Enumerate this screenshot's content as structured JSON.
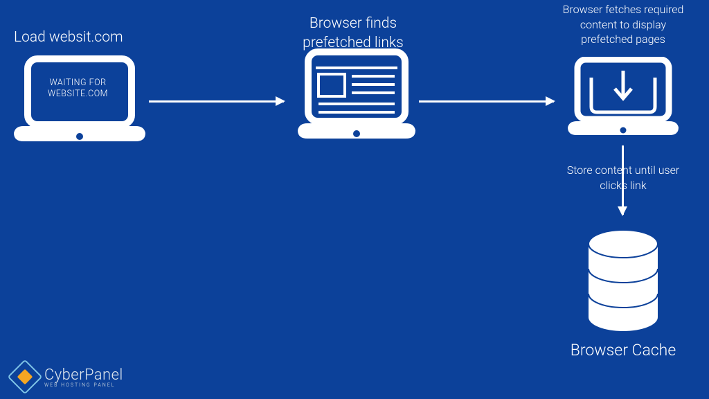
{
  "steps": {
    "s1": {
      "label": "Load websit.com",
      "screen_text": "WAITING FOR WEBSITE.COM"
    },
    "s2": {
      "label": "Browser finds prefetched links"
    },
    "s3": {
      "label": "Browser fetches required content to display prefetched pages"
    },
    "s4": {
      "label": "Store content until user clicks link"
    }
  },
  "cache": {
    "label": "Browser Cache"
  },
  "brand": {
    "name": "CyberPanel",
    "tagline": "WEB HOSTING PANEL"
  },
  "colors": {
    "bg": "#0c419a",
    "fg": "#ffffff",
    "accent": "#f5a623",
    "logo_edge": "#7ec3e6"
  }
}
